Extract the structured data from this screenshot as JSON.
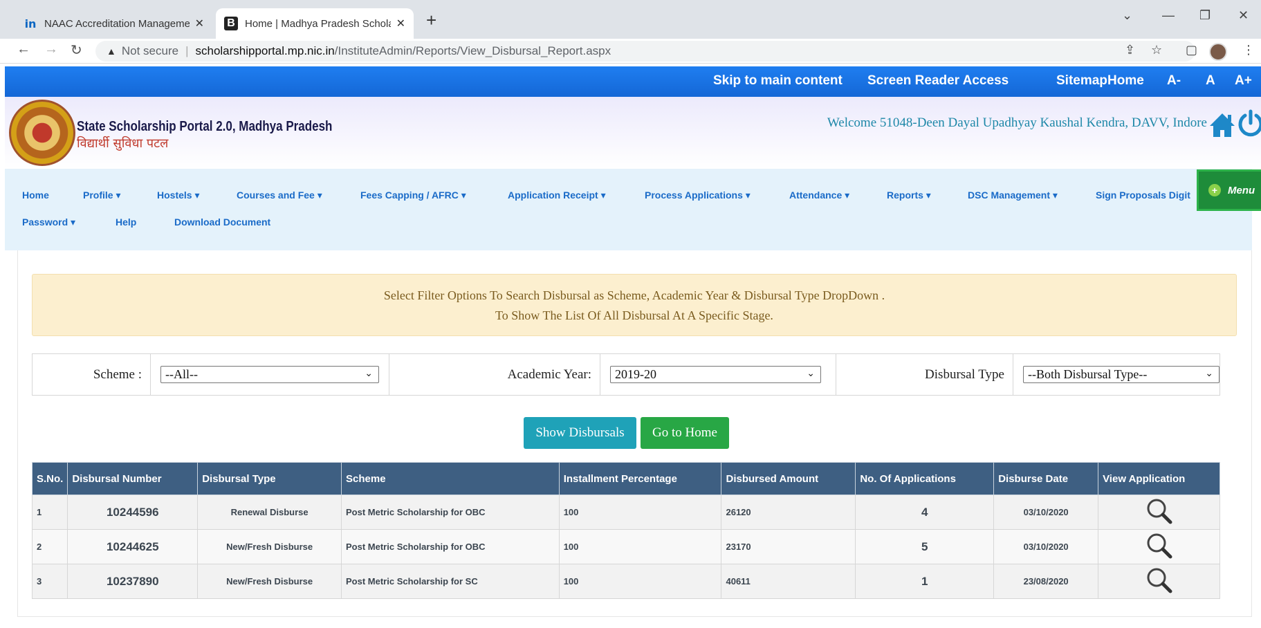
{
  "browser": {
    "tabs": [
      {
        "title": "NAAC Accreditation Managemen",
        "favicon": "linkedin-icon",
        "active": false
      },
      {
        "title": "Home | Madhya Pradesh Scholar",
        "favicon": "b-icon",
        "active": true
      }
    ],
    "close_glyph": "✕",
    "new_tab_glyph": "+",
    "security_label": "Not secure",
    "url_host": "scholarshipportal.mp.nic.in",
    "url_path": "/InstituteAdmin/Reports/View_Disbursal_Report.aspx"
  },
  "topbar": {
    "links": [
      "Skip to main content",
      "Screen Reader Access",
      "Sitemap",
      "Home",
      "A-",
      "A",
      "A+"
    ]
  },
  "header": {
    "title": "State Scholarship Portal 2.0, Madhya Pradesh",
    "subtitle": "विद्यार्थी सुविधा पटल",
    "welcome": "Welcome 51048-Deen Dayal Upadhyay Kaushal Kendra, DAVV, Indore"
  },
  "nav": {
    "row1": [
      "Home",
      "Profile ▾",
      "Hostels ▾",
      "Courses and Fee ▾",
      "Fees Capping / AFRC ▾",
      "Application Receipt ▾",
      "Process Applications ▾",
      "Attendance ▾",
      "Reports ▾",
      "DSC Management ▾",
      "Sign Proposals Digit"
    ],
    "row2": [
      "Password ▾",
      "Help",
      "Download Document"
    ],
    "menu_label": "Menu",
    "menu_plus": "+"
  },
  "notice": {
    "line1": "Select Filter Options To Search Disbursal as Scheme, Academic Year & Disbursal Type DropDown .",
    "line2": "To Show The List Of All Disbursal At A Specific Stage."
  },
  "filters": {
    "scheme_label": "Scheme :",
    "scheme_value": "--All--",
    "year_label": "Academic Year:",
    "year_value": "2019-20",
    "type_label": "Disbursal Type",
    "type_value": "--Both Disbursal Type--",
    "chevron": "⌄"
  },
  "buttons": {
    "show": "Show Disbursals",
    "home": "Go to Home"
  },
  "table": {
    "headers": [
      "S.No.",
      "Disbursal Number",
      "Disbursal Type",
      "Scheme",
      "Installment Percentage",
      "Disbursed Amount",
      "No. Of Applications",
      "Disburse Date",
      "View Application"
    ],
    "rows": [
      [
        "1",
        "10244596",
        "Renewal Disburse",
        "Post Metric Scholarship for OBC",
        "100",
        "26120",
        "4",
        "03/10/2020"
      ],
      [
        "2",
        "10244625",
        "New/Fresh Disburse",
        "Post Metric Scholarship for OBC",
        "100",
        "23170",
        "5",
        "03/10/2020"
      ],
      [
        "3",
        "10237890",
        "New/Fresh Disburse",
        "Post Metric Scholarship for SC",
        "100",
        "40611",
        "1",
        "23/08/2020"
      ]
    ]
  },
  "colors": {
    "topbar": "#1f7ef0",
    "nav_text": "#1a6bc8",
    "table_header": "#3e5f82",
    "show_button": "#1fa2b8",
    "home_button": "#28a745",
    "welcome_text": "#1e88a8"
  }
}
